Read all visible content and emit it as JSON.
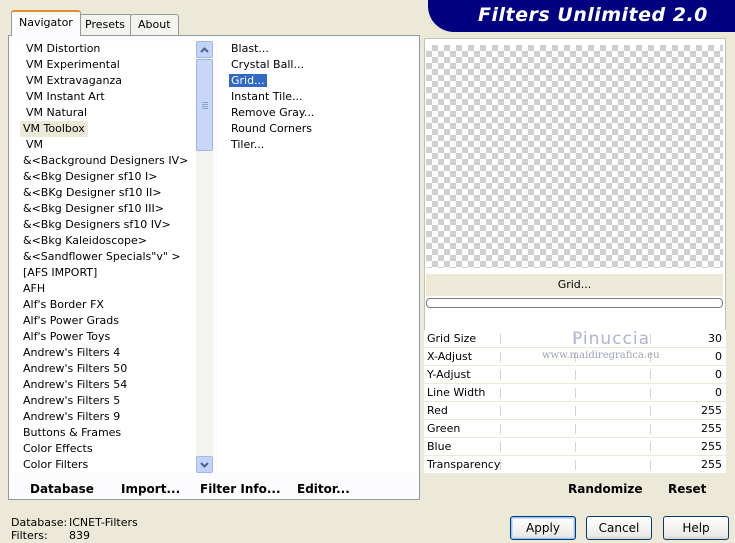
{
  "banner": {
    "title": "Filters Unlimited 2.0"
  },
  "tabs": [
    {
      "label": "Navigator",
      "active": true
    },
    {
      "label": "Presets",
      "active": false
    },
    {
      "label": "About",
      "active": false
    }
  ],
  "categories": [
    "VM Distortion",
    "VM Experimental",
    "VM Extravaganza",
    "VM Instant Art",
    "VM Natural",
    "VM Toolbox",
    "VM",
    "&<Background Designers IV>",
    "&<Bkg Designer sf10 I>",
    "&<BKg Designer sf10 II>",
    "&<Bkg Designer sf10 III>",
    "&<Bkg Designers sf10 IV>",
    "&<Bkg Kaleidoscope>",
    "&<Sandflower Specials\"v\" >",
    "[AFS IMPORT]",
    "AFH",
    "Alf's Border FX",
    "Alf's Power Grads",
    "Alf's Power Toys",
    "Andrew's Filters 4",
    "Andrew's Filters 50",
    "Andrew's Filters 54",
    "Andrew's Filters 5",
    "Andrew's Filters 9",
    "Buttons & Frames",
    "Color Effects",
    "Color Filters"
  ],
  "selected_category": "VM Toolbox",
  "filters": [
    "Blast...",
    "Crystal Ball...",
    "Grid...",
    "Instant Tile...",
    "Remove Gray...",
    "Round Corners",
    "Tiler..."
  ],
  "selected_filter": "Grid...",
  "left_buttons": {
    "database": "Database",
    "import": "Import...",
    "filter_info": "Filter Info...",
    "editor": "Editor..."
  },
  "preview_label": "Grid...",
  "params": [
    {
      "label": "Grid Size",
      "value": "30"
    },
    {
      "label": "X-Adjust",
      "value": "0"
    },
    {
      "label": "Y-Adjust",
      "value": "0"
    },
    {
      "label": "Line Width",
      "value": "0"
    },
    {
      "label": "Red",
      "value": "255"
    },
    {
      "label": "Green",
      "value": "255"
    },
    {
      "label": "Blue",
      "value": "255"
    },
    {
      "label": "Transparency",
      "value": "255"
    }
  ],
  "watermark": {
    "name": "Pinuccia",
    "url": "www.maidiregrafica.eu"
  },
  "right_buttons": {
    "randomize": "Randomize",
    "reset": "Reset"
  },
  "status": {
    "database_label": "Database:",
    "database_value": "ICNET-Filters",
    "filters_label": "Filters:",
    "filters_value": "839"
  },
  "dialog_buttons": {
    "apply": "Apply",
    "cancel": "Cancel",
    "help": "Help"
  },
  "colors": {
    "banner": "#000080",
    "selection": "#316ac5",
    "tab_accent": "#e68b2c",
    "face": "#ece9d8"
  }
}
